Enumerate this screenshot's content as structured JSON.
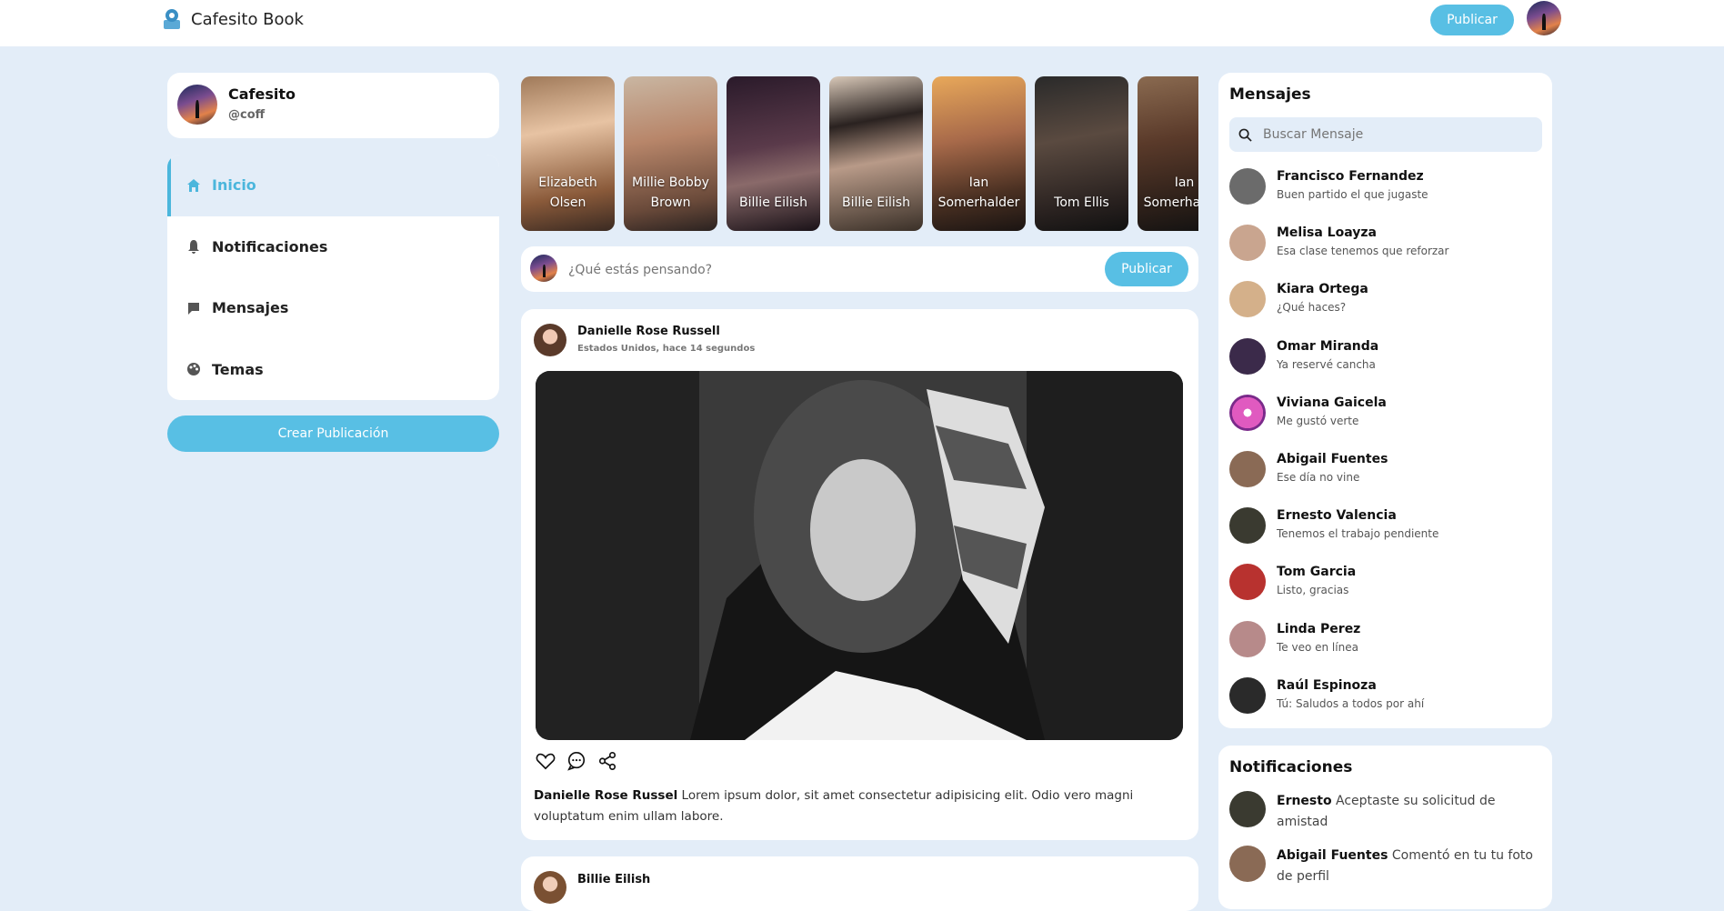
{
  "header": {
    "brand_name": "Cafesito Book",
    "publish_label": "Publicar"
  },
  "profile": {
    "name": "Cafesito",
    "handle": "@coff"
  },
  "nav": {
    "items": [
      {
        "label": "Inicio",
        "icon": "home-icon",
        "active": true
      },
      {
        "label": "Notificaciones",
        "icon": "bell-icon"
      },
      {
        "label": "Mensajes",
        "icon": "chat-icon"
      },
      {
        "label": "Temas",
        "icon": "palette-icon"
      }
    ],
    "create_label": "Crear Publicación"
  },
  "stories": [
    {
      "name": "Elizabeth Olsen",
      "line1": "Elizabeth",
      "line2": "Olsen"
    },
    {
      "name": "Millie Bobby Brown",
      "line1": "Millie Bobby",
      "line2": "Brown"
    },
    {
      "name": "Billie Eilish",
      "line1": "Billie Eilish",
      "line2": ""
    },
    {
      "name": "Billie Eilish",
      "line1": "Billie Eilish",
      "line2": ""
    },
    {
      "name": "Ian Somerhalder",
      "line1": "Ian",
      "line2": "Somerhalder"
    },
    {
      "name": "Tom Ellis",
      "line1": "Tom Ellis",
      "line2": ""
    },
    {
      "name": "Ian Somerhalder",
      "line1": "Ian",
      "line2": "Somerhalder"
    }
  ],
  "composer": {
    "placeholder": "¿Qué estás pensando?",
    "button_label": "Publicar"
  },
  "post": {
    "author": "Danielle Rose Russell",
    "meta": "Estados Unidos, hace 14 segundos",
    "caption_author": "Danielle Rose Russel",
    "caption_text": " Lorem ipsum dolor, sit amet consectetur adipisicing elit. Odio vero magni voluptatum enim ullam labore."
  },
  "post2": {
    "author": "Billie Eilish"
  },
  "messages": {
    "title": "Mensajes",
    "search_placeholder": "Buscar Mensaje",
    "items": [
      {
        "name": "Francisco Fernandez",
        "text": "Buen partido el que jugaste",
        "color": "#6b6b6b"
      },
      {
        "name": "Melisa Loayza",
        "text": "Esa clase tenemos que reforzar",
        "color": "#c9a58f"
      },
      {
        "name": "Kiara Ortega",
        "text": "¿Qué haces?",
        "color": "#d4b08a"
      },
      {
        "name": "Omar Miranda",
        "text": "Ya reservé cancha",
        "color": "#3b2a4a"
      },
      {
        "name": "Viviana Gaicela",
        "text": "Me gustó verte",
        "color": "#c43fa0"
      },
      {
        "name": "Abigail Fuentes",
        "text": "Ese día no vine",
        "color": "#8a6a55"
      },
      {
        "name": "Ernesto Valencia",
        "text": "Tenemos el trabajo pendiente",
        "color": "#3a3a30"
      },
      {
        "name": "Tom Garcia",
        "text": "Listo, gracias",
        "color": "#b8322f"
      },
      {
        "name": "Linda Perez",
        "text": "Te veo en línea",
        "color": "#b78a8a"
      },
      {
        "name": "Raúl Espinoza",
        "text": "Tú: Saludos a todos por ahí",
        "color": "#2a2a2a"
      }
    ]
  },
  "notifications": {
    "title": "Notificaciones",
    "items": [
      {
        "name": "Ernesto",
        "text": " Aceptaste su solicitud de amistad",
        "color": "#3a3a30"
      },
      {
        "name": "Abigail Fuentes",
        "text": " Comentó en tu tu foto de perfil",
        "color": "#8a6a55"
      }
    ]
  },
  "colors": {
    "accent": "#58bfe4",
    "background": "#e3edf8"
  }
}
